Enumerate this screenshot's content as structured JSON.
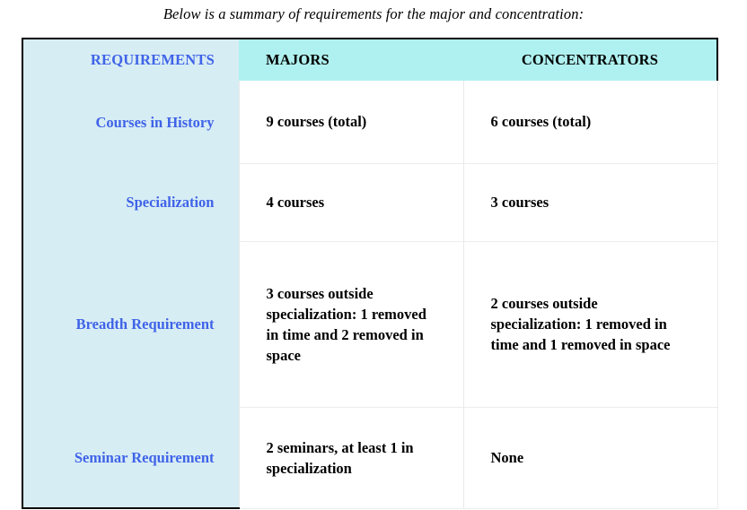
{
  "intro": {
    "text": "Below is a summary of requirements for the major and concentration:"
  },
  "colors": {
    "label_column_bg": "#d7edf4",
    "header_bg": "#aff1f0",
    "label_text": "#3f63e8",
    "body_text": "#000000",
    "outer_border": "#000000",
    "inner_border": "#ededed"
  },
  "table": {
    "headers": {
      "requirements": "REQUIREMENTS",
      "majors": "MAJORS",
      "concentrators": "CONCENTRATORS"
    },
    "rows": [
      {
        "label": "Courses in History",
        "majors": "9 courses (total)",
        "concentrators": "6 courses (total)"
      },
      {
        "label": "Specialization",
        "majors": "4 courses",
        "concentrators": "3 courses"
      },
      {
        "label": "Breadth Requirement",
        "majors": "3 courses outside specialization: 1 removed in time and 2 removed in space",
        "concentrators": "2 courses outside specialization: 1 removed in time and 1 removed in space"
      },
      {
        "label": "Seminar Requirement",
        "majors": "2 seminars, at least 1 in specialization",
        "concentrators": "None"
      }
    ]
  }
}
